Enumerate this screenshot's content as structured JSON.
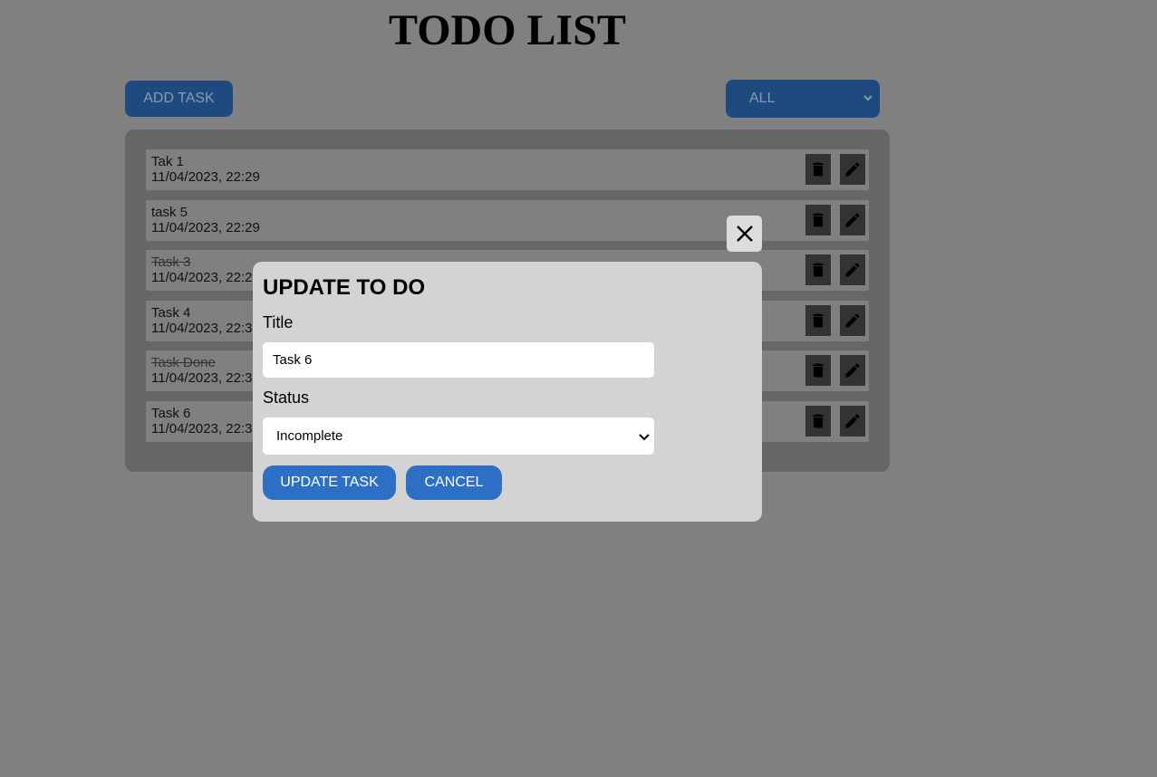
{
  "header": {
    "title": "TODO LIST"
  },
  "toolbar": {
    "add_label": "ADD TASK",
    "filter_selected": "ALL"
  },
  "tasks": [
    {
      "title": "Tak 1",
      "date": "11/04/2023, 22:29",
      "done": false
    },
    {
      "title": "task 5",
      "date": "11/04/2023, 22:29",
      "done": false
    },
    {
      "title": "Task 3",
      "date": "11/04/2023, 22:29",
      "done": true
    },
    {
      "title": "Task 4",
      "date": "11/04/2023, 22:30",
      "done": false
    },
    {
      "title": "Task Done",
      "date": "11/04/2023, 22:30",
      "done": true
    },
    {
      "title": "Task 6",
      "date": "11/04/2023, 22:30",
      "done": false
    }
  ],
  "icons": {
    "delete": "trash-icon",
    "edit": "pencil-icon",
    "close": "close-icon",
    "dropdown": "chevron-down-icon"
  },
  "modal": {
    "title": "UPDATE TO DO",
    "title_label": "Title",
    "title_value": "Task 6",
    "status_label": "Status",
    "status_value": "Incomplete",
    "update_label": "UPDATE TASK",
    "cancel_label": "CANCEL"
  },
  "colors": {
    "overlay_bg": "#808080",
    "accent": "#2d6fc4",
    "dimmed_accent": "#1e4a7f"
  }
}
